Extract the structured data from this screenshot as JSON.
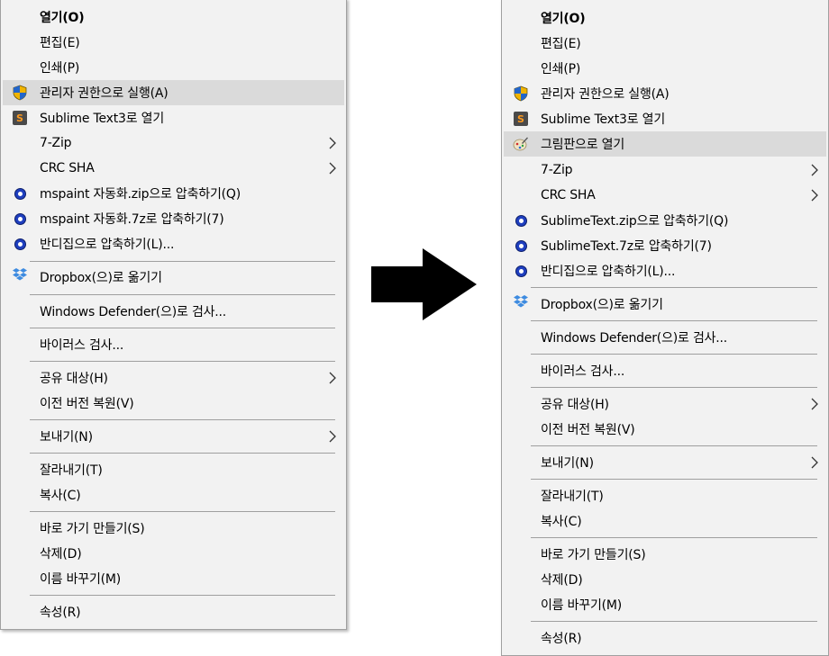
{
  "left_menu": {
    "items": [
      {
        "label": "열기(O)",
        "bold": true,
        "icon": null,
        "submenu": false,
        "highlighted": false
      },
      {
        "label": "편집(E)",
        "icon": null,
        "submenu": false
      },
      {
        "label": "인쇄(P)",
        "icon": null,
        "submenu": false
      },
      {
        "label": "관리자 권한으로 실행(A)",
        "icon": "uac-shield-icon",
        "submenu": false,
        "highlighted": true
      },
      {
        "label": "Sublime Text3로 열기",
        "icon": "sublime-text-icon",
        "submenu": false
      },
      {
        "label": "7-Zip",
        "icon": null,
        "submenu": true
      },
      {
        "label": "CRC SHA",
        "icon": null,
        "submenu": true
      },
      {
        "label": "mspaint 자동화.zip으로 압축하기(Q)",
        "icon": "bandizip-icon",
        "submenu": false
      },
      {
        "label": "mspaint 자동화.7z로 압축하기(7)",
        "icon": "bandizip-icon",
        "submenu": false
      },
      {
        "label": "반디집으로 압축하기(L)...",
        "icon": "bandizip-icon",
        "submenu": false
      },
      {
        "label": "Dropbox(으)로 옮기기",
        "icon": "dropbox-icon",
        "submenu": false
      },
      {
        "label": "Windows Defender(으)로 검사...",
        "icon": null,
        "submenu": false
      },
      {
        "label": "바이러스 검사...",
        "icon": null,
        "submenu": false
      },
      {
        "label": "공유 대상(H)",
        "icon": null,
        "submenu": true
      },
      {
        "label": "이전 버전 복원(V)",
        "icon": null,
        "submenu": false
      },
      {
        "label": "보내기(N)",
        "icon": null,
        "submenu": true
      },
      {
        "label": "잘라내기(T)",
        "icon": null,
        "submenu": false
      },
      {
        "label": "복사(C)",
        "icon": null,
        "submenu": false
      },
      {
        "label": "바로 가기 만들기(S)",
        "icon": null,
        "submenu": false
      },
      {
        "label": "삭제(D)",
        "icon": null,
        "submenu": false
      },
      {
        "label": "이름 바꾸기(M)",
        "icon": null,
        "submenu": false
      },
      {
        "label": "속성(R)",
        "icon": null,
        "submenu": false
      }
    ]
  },
  "right_menu": {
    "items": [
      {
        "label": "열기(O)",
        "bold": true,
        "icon": null,
        "submenu": false
      },
      {
        "label": "편집(E)",
        "icon": null,
        "submenu": false
      },
      {
        "label": "인쇄(P)",
        "icon": null,
        "submenu": false
      },
      {
        "label": "관리자 권한으로 실행(A)",
        "icon": "uac-shield-icon",
        "submenu": false
      },
      {
        "label": "Sublime Text3로 열기",
        "icon": "sublime-text-icon",
        "submenu": false
      },
      {
        "label": "그림판으로 열기",
        "icon": "paint-icon",
        "submenu": false,
        "highlighted": true
      },
      {
        "label": "7-Zip",
        "icon": null,
        "submenu": true
      },
      {
        "label": "CRC SHA",
        "icon": null,
        "submenu": true
      },
      {
        "label": "SublimeText.zip으로 압축하기(Q)",
        "icon": "bandizip-icon",
        "submenu": false
      },
      {
        "label": "SublimeText.7z로 압축하기(7)",
        "icon": "bandizip-icon",
        "submenu": false
      },
      {
        "label": "반디집으로 압축하기(L)...",
        "icon": "bandizip-icon",
        "submenu": false
      },
      {
        "label": "Dropbox(으)로 옮기기",
        "icon": "dropbox-icon",
        "submenu": false
      },
      {
        "label": "Windows Defender(으)로 검사...",
        "icon": null,
        "submenu": false
      },
      {
        "label": "바이러스 검사...",
        "icon": null,
        "submenu": false
      },
      {
        "label": "공유 대상(H)",
        "icon": null,
        "submenu": true
      },
      {
        "label": "이전 버전 복원(V)",
        "icon": null,
        "submenu": false
      },
      {
        "label": "보내기(N)",
        "icon": null,
        "submenu": true
      },
      {
        "label": "잘라내기(T)",
        "icon": null,
        "submenu": false
      },
      {
        "label": "복사(C)",
        "icon": null,
        "submenu": false
      },
      {
        "label": "바로 가기 만들기(S)",
        "icon": null,
        "submenu": false
      },
      {
        "label": "삭제(D)",
        "icon": null,
        "submenu": false
      },
      {
        "label": "이름 바꾸기(M)",
        "icon": null,
        "submenu": false
      },
      {
        "label": "속성(R)",
        "icon": null,
        "submenu": false
      }
    ]
  },
  "arrow_icon": "right-arrow-icon",
  "colors": {
    "menu_bg": "#f2f2f2",
    "highlight": "#dadada",
    "separator": "#9f9f9f",
    "arrow": "#000000"
  }
}
